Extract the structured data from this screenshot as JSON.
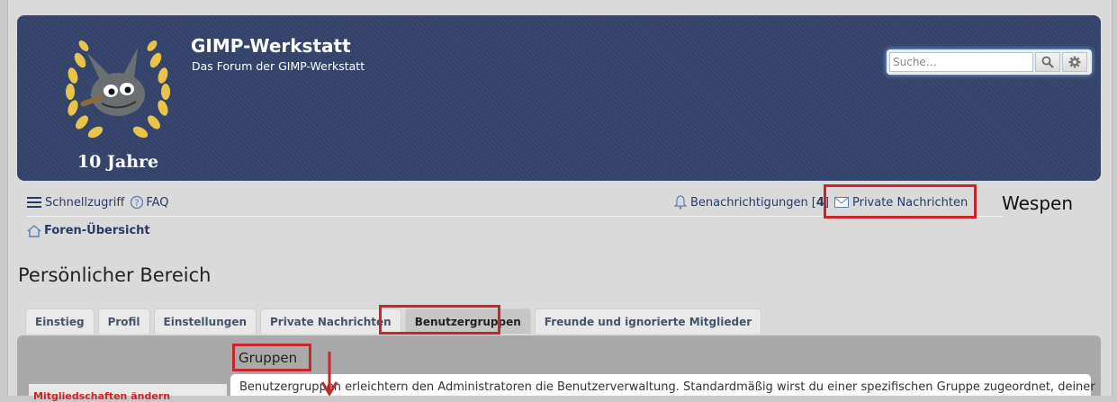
{
  "header": {
    "site_title": "GIMP-Werkstatt",
    "site_description": "Das Forum der GIMP-Werkstatt",
    "logo_caption": "10 Jahre",
    "logo_icon": "wilber-laurel-logo",
    "search_placeholder": "Suche…",
    "search_icon": "search-icon",
    "advanced_search_icon": "gear-icon"
  },
  "navbar": {
    "quicklinks_label": "Schnellzugriff",
    "faq_label": "FAQ",
    "notifications_label": "Benachrichtigungen",
    "notifications_count_open": "[",
    "notifications_count": "4",
    "notifications_count_close": "]",
    "private_messages_label": "Private Nachrichten",
    "breadcrumb_home": "Foren-Übersicht"
  },
  "annotation_username": "Wespen",
  "page": {
    "title": "Persönlicher Bereich",
    "tabs": [
      {
        "label": "Einstieg",
        "active": false
      },
      {
        "label": "Profil",
        "active": false
      },
      {
        "label": "Einstellungen",
        "active": false
      },
      {
        "label": "Private Nachrichten",
        "active": false
      },
      {
        "label": "Benutzergruppen",
        "active": true
      },
      {
        "label": "Freunde und ignorierte Mitglieder",
        "active": false
      }
    ],
    "groups_heading": "Gruppen",
    "groups_intro": "Benutzergruppen erleichtern den Administratoren die Benutzerverwaltung. Standardmäßig wirst du einer spezifischen Gruppe zugeordnet, deiner",
    "sidebar_link": "Mitgliedschaften ändern"
  },
  "colors": {
    "header_bg": "#33436a",
    "link": "#2a3a66",
    "highlight_red": "#c8262a"
  }
}
